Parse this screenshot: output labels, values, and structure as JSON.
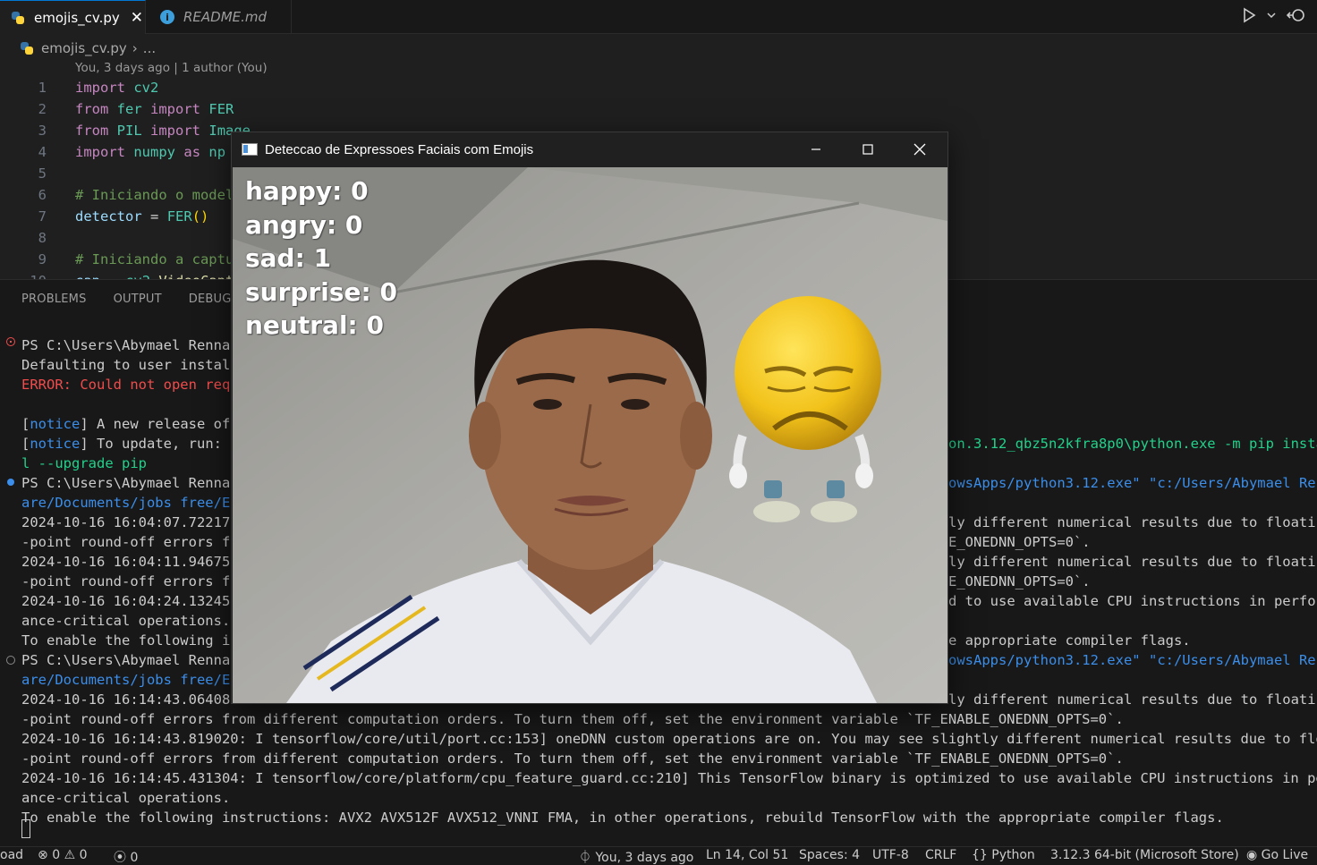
{
  "tabs": [
    {
      "label": "emojis_cv.py",
      "active": true
    },
    {
      "label": "README.md",
      "active": false
    }
  ],
  "breadcrumb": {
    "file": "emojis_cv.py",
    "rest": "..."
  },
  "editor": {
    "blame": "You, 3 days ago | 1 author (You)",
    "line_numbers": [
      "1",
      "2",
      "3",
      "4",
      "5",
      "6",
      "7",
      "8",
      "9",
      "10"
    ]
  },
  "panel_tabs": [
    "PROBLEMS",
    "OUTPUT",
    "DEBUG C"
  ],
  "terminal": {
    "left_lines": [
      "PS C:\\Users\\Abymael Rennar",
      "Defaulting to user install",
      "ERROR: Could not open requ",
      "",
      "[notice] A new release of",
      "[notice] To update, run: C",
      "l --upgrade pip",
      "PS C:\\Users\\Abymael Rennar",
      "are/Documents/jobs free/Em",
      "2024-10-16 16:04:07.722176",
      "-point round-off errors fr",
      "2024-10-16 16:04:11.946753",
      "-point round-off errors fr",
      "2024-10-16 16:04:24.132458",
      "ance-critical operations.",
      "To enable the following in",
      "PS C:\\Users\\Abymael Rennar",
      "are/Documents/jobs free/Em",
      "2024-10-16 16:14:43.064087"
    ],
    "right_fragments": {
      "r6": "on.3.12_qbz5n2kfra8p0\\python.exe -m pip instal",
      "r8a": "owsApps/python3.12.exe\"",
      "r8b": "\"c:/Users/Abymael Renn",
      "r10": "ly different numerical results due to floating",
      "r11": "E_ONEDNN_OPTS=0`.",
      "r12": "ly different numerical results due to floating",
      "r13": "E_ONEDNN_OPTS=0`.",
      "r14": "d to use available CPU instructions in perform",
      "r16": "e appropriate compiler flags.",
      "r17a": "owsApps/python3.12.exe\"",
      "r17b": "\"c:/Users/Abymael Renn",
      "r19": "ly different numerical results due to floating"
    },
    "full_lines": [
      "-point round-off errors from different computation orders. To turn them off, set the environment variable `TF_ENABLE_ONEDNN_OPTS=0`.",
      "2024-10-16 16:14:43.819020: I tensorflow/core/util/port.cc:153] oneDNN custom operations are on. You may see slightly different numerical results due to floating",
      "-point round-off errors from different computation orders. To turn them off, set the environment variable `TF_ENABLE_ONEDNN_OPTS=0`.",
      "2024-10-16 16:14:45.431304: I tensorflow/core/platform/cpu_feature_guard.cc:210] This TensorFlow binary is optimized to use available CPU instructions in perform",
      "ance-critical operations.",
      "To enable the following instructions: AVX2 AVX512F AVX512_VNNI FMA, in other operations, rebuild TensorFlow with the appropriate compiler flags."
    ]
  },
  "statusbar": {
    "left_clip": "oad",
    "errors": "0",
    "warnings": "0",
    "ports": "0",
    "blame": "You, 3 days ago",
    "position": "Ln 14, Col 51",
    "spaces": "Spaces: 4",
    "encoding": "UTF-8",
    "eol": "CRLF",
    "language": "Python",
    "interpreter": "3.12.3 64-bit (Microsoft Store)",
    "golive": "Go Live"
  },
  "cv_window": {
    "title": "Deteccao de Expressoes Faciais com Emojis",
    "emotions": [
      {
        "label": "happy",
        "value": "0"
      },
      {
        "label": "angry",
        "value": "0"
      },
      {
        "label": "sad",
        "value": "1"
      },
      {
        "label": "surprise",
        "value": "0"
      },
      {
        "label": "neutral",
        "value": "0"
      }
    ]
  },
  "colors": {
    "accent": "#0078d4",
    "error": "#f14c4c",
    "notice": "#3b8eea",
    "emoji_yellow": "#f2c21a"
  }
}
